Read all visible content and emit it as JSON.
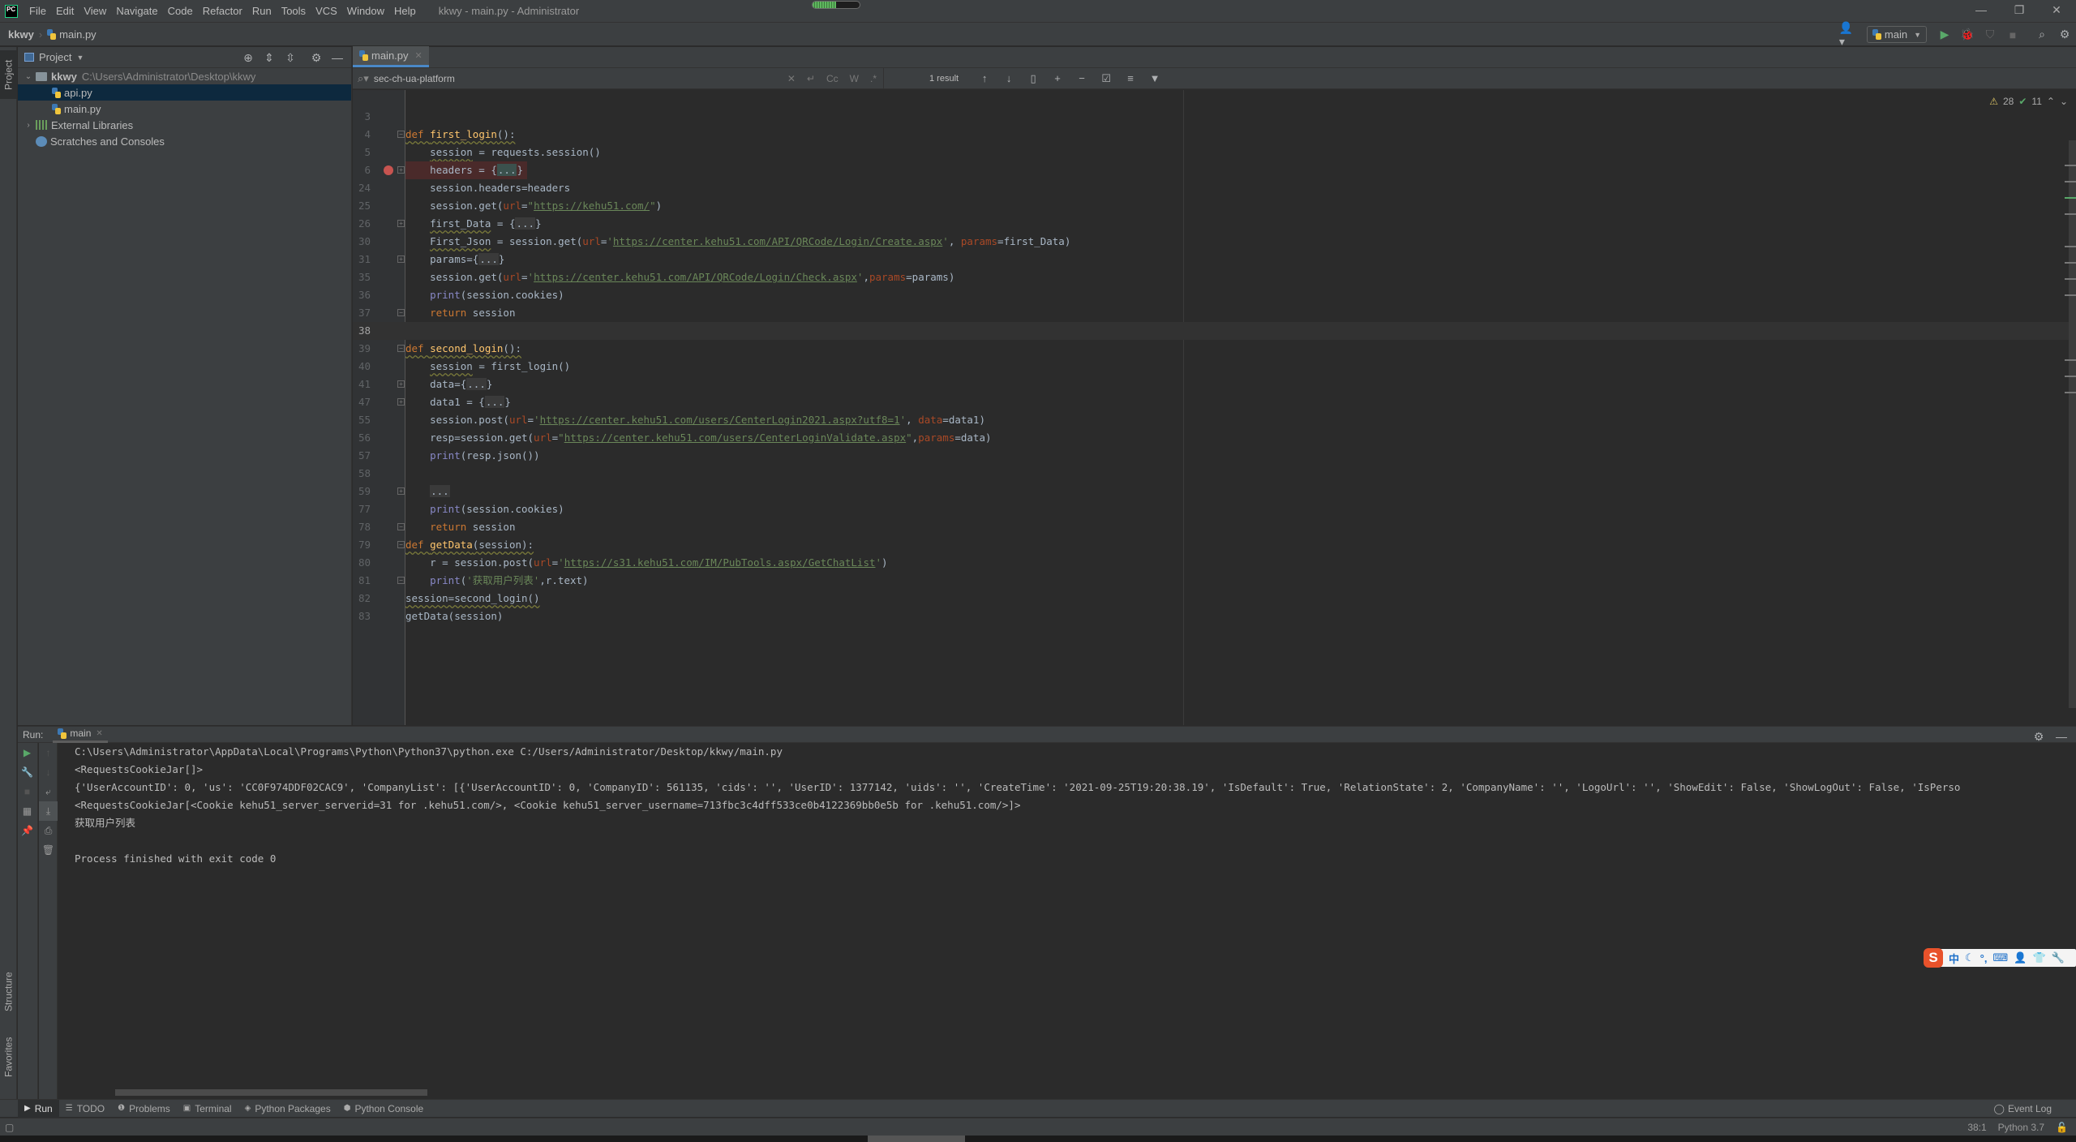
{
  "window": {
    "app_logo": "PC",
    "title": "kkwy - main.py - Administrator",
    "progress_fraction": 0.5,
    "controls": [
      "minimize",
      "restore",
      "close"
    ]
  },
  "menu": [
    "File",
    "Edit",
    "View",
    "Navigate",
    "Code",
    "Refactor",
    "Run",
    "Tools",
    "VCS",
    "Window",
    "Help"
  ],
  "breadcrumb": {
    "root": "kkwy",
    "file": "main.py"
  },
  "toolbar": {
    "run_config": "main",
    "icons": [
      "user-icon",
      "run-icon",
      "debug-icon",
      "coverage-icon",
      "stop-icon",
      "search-icon",
      "gear-icon"
    ]
  },
  "left_strip": {
    "top_tab": "Project",
    "bottom_tabs": [
      "Structure",
      "Favorites"
    ]
  },
  "project": {
    "title": "Project",
    "tree": [
      {
        "label": "kkwy",
        "path": "C:\\Users\\Administrator\\Desktop\\kkwy",
        "type": "folder",
        "expanded": true
      },
      {
        "label": "api.py",
        "type": "file",
        "selected": true
      },
      {
        "label": "main.py",
        "type": "file"
      },
      {
        "label": "External Libraries",
        "type": "library",
        "expanded": false
      },
      {
        "label": "Scratches and Consoles",
        "type": "scratch"
      }
    ]
  },
  "editor": {
    "tab": "main.py",
    "find": {
      "query": "sec-ch-ua-platform",
      "options": [
        "Cc",
        "W",
        ".*"
      ],
      "result": "1 result"
    },
    "inspection": {
      "warnings": "28",
      "weak_warnings": "11"
    },
    "current_line": "38",
    "breakpoint_line": "6"
  },
  "run": {
    "label": "Run:",
    "tab": "main",
    "console": [
      "C:\\Users\\Administrator\\AppData\\Local\\Programs\\Python\\Python37\\python.exe C:/Users/Administrator/Desktop/kkwy/main.py",
      "<RequestsCookieJar[]>",
      "{'UserAccountID': 0, 'us': 'CC0F974DDF02CAC9', 'CompanyList': [{'UserAccountID': 0, 'CompanyID': 561135, 'cids': '', 'UserID': 1377142, 'uids': '', 'CreateTime': '2021-09-25T19:20:38.19', 'IsDefault': True, 'RelationState': 2, 'CompanyName': '', 'LogoUrl': '', 'ShowEdit': False, 'ShowLogOut': False, 'IsPerso",
      "<RequestsCookieJar[<Cookie kehu51_server_serverid=31 for .kehu51.com/>, <Cookie kehu51_server_username=713fbc3c4dff533ce0b4122369bb0e5b for .kehu51.com/>]>",
      "获取用户列表",
      "",
      "Process finished with exit code 0"
    ]
  },
  "bottom_tabs": [
    "Run",
    "TODO",
    "Problems",
    "Terminal",
    "Python Packages",
    "Python Console"
  ],
  "event_log": "Event Log",
  "status": {
    "position": "38:1",
    "interpreter": "Python 3.7"
  },
  "ime": {
    "logo": "S",
    "mode": "中"
  }
}
